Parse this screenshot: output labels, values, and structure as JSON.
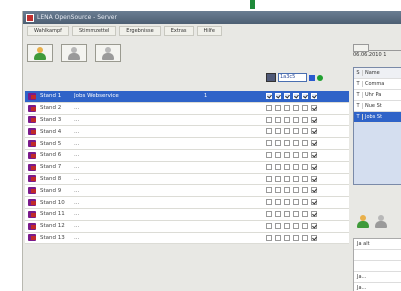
{
  "window": {
    "title": "LENA OpenSource - Server"
  },
  "menu": [
    "Wahlkampf",
    "Stimmzettel",
    "Ergebnisse",
    "Extras",
    "Hilfe"
  ],
  "header_tools": {
    "combo_value": "1a3c5"
  },
  "rows": [
    {
      "name": "Stand 1",
      "desc": "Jobs Webservice",
      "num": "1",
      "selected": true,
      "last_checked": false
    },
    {
      "name": "Stand 2",
      "desc": "...",
      "num": "",
      "selected": false,
      "last_checked": true
    },
    {
      "name": "Stand 3",
      "desc": "...",
      "num": "",
      "selected": false,
      "last_checked": true
    },
    {
      "name": "Stand 4",
      "desc": "...",
      "num": "",
      "selected": false,
      "last_checked": true
    },
    {
      "name": "Stand 5",
      "desc": "...",
      "num": "",
      "selected": false,
      "last_checked": true
    },
    {
      "name": "Stand 6",
      "desc": "...",
      "num": "",
      "selected": false,
      "last_checked": true
    },
    {
      "name": "Stand 7",
      "desc": "...",
      "num": "",
      "selected": false,
      "last_checked": true
    },
    {
      "name": "Stand 8",
      "desc": "...",
      "num": "",
      "selected": false,
      "last_checked": true
    },
    {
      "name": "Stand 9",
      "desc": "...",
      "num": "",
      "selected": false,
      "last_checked": true
    },
    {
      "name": "Stand 10",
      "desc": "...",
      "num": "",
      "selected": false,
      "last_checked": true
    },
    {
      "name": "Stand 11",
      "desc": "...",
      "num": "",
      "selected": false,
      "last_checked": true
    },
    {
      "name": "Stand 12",
      "desc": "...",
      "num": "",
      "selected": false,
      "last_checked": true
    },
    {
      "name": "Stand 13",
      "desc": "...",
      "num": "",
      "selected": false,
      "last_checked": true
    }
  ],
  "right_panel": {
    "date": "06.06.2010 1",
    "list_header": {
      "c1": "S",
      "c2": "Name"
    },
    "items": [
      {
        "c1": "T",
        "c2": "Comma",
        "selected": false
      },
      {
        "c1": "T",
        "c2": "Uhr Pa",
        "selected": false
      },
      {
        "c1": "T",
        "c2": "Nue St",
        "selected": false
      },
      {
        "c1": "T",
        "c2": "Jobs St",
        "selected": true
      }
    ],
    "bottom_rows": [
      "Ja   alt",
      "",
      "",
      "Ja... ",
      "Ja..."
    ]
  }
}
